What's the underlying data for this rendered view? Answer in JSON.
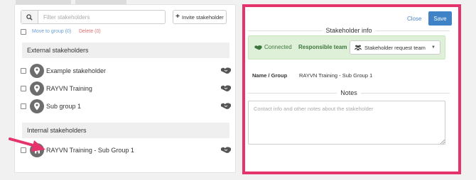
{
  "search": {
    "placeholder": "Filter stakeholders"
  },
  "toolbar": {
    "invite_label": "Invite stakeholder"
  },
  "bulk_actions": {
    "move_label": "Move to group (0)",
    "delete_label": "Delete (0)"
  },
  "external_section": {
    "title": "External stakeholders",
    "items": [
      {
        "name": "Example stakeholder",
        "icon": "map-pin-icon"
      },
      {
        "name": "RAYVN Training",
        "icon": "map-pin-icon"
      },
      {
        "name": "Sub group 1",
        "icon": "map-pin-icon"
      }
    ]
  },
  "internal_section": {
    "title": "Internal stakeholders",
    "items": [
      {
        "name": "RAYVN Training - Sub Group 1",
        "icon": "home-icon"
      }
    ]
  },
  "detail": {
    "close_label": "Close",
    "save_label": "Save",
    "info_legend": "Stakeholder info",
    "status": "Connected",
    "responsible_label": "Responsible team",
    "team_value": "Stakeholder request team",
    "name_label": "Name / Group",
    "name_value": "RAYVN Training - Sub Group 1",
    "notes_legend": "Notes",
    "notes_placeholder": "Contact info and other notes about the stakeholder"
  },
  "colors": {
    "highlight_border": "#e5336b",
    "primary": "#3f83c6",
    "success_bg": "#dff0d8",
    "success_text": "#3c763d",
    "arrow": "#e5336b"
  }
}
